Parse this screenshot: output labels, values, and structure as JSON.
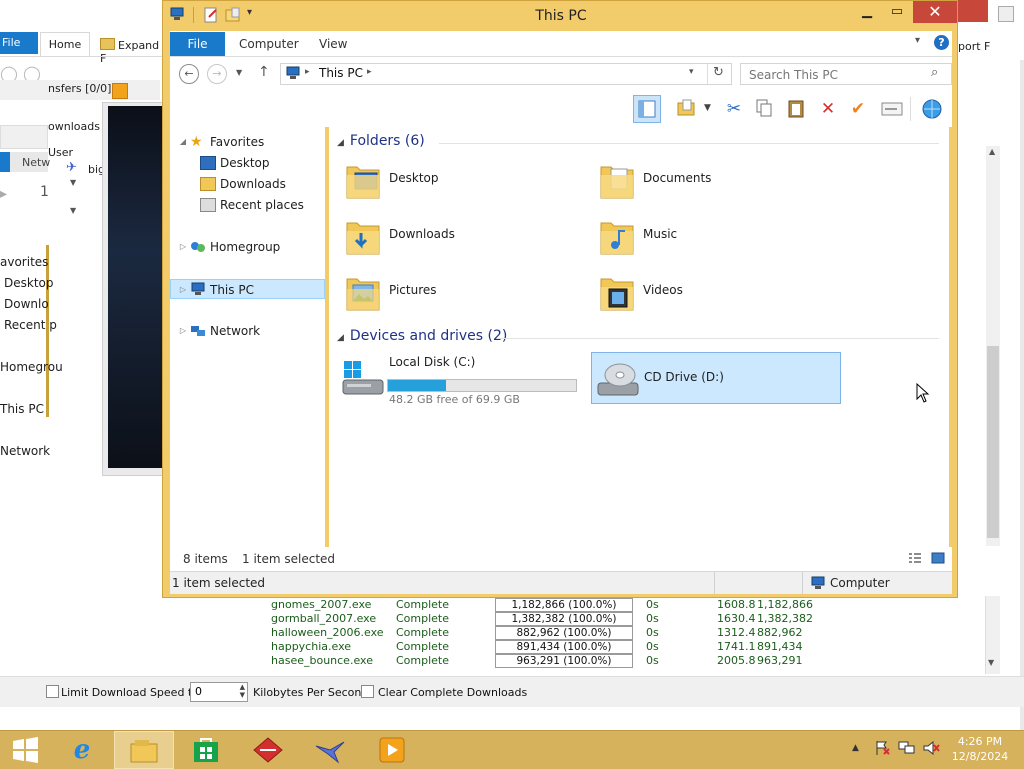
{
  "explorer": {
    "title": "This PC",
    "tabs": {
      "file": "File",
      "computer": "Computer",
      "view": "View"
    },
    "address": {
      "path": "This PC"
    },
    "search": {
      "placeholder": "Search This PC"
    },
    "nav": {
      "favorites": "Favorites",
      "desktop": "Desktop",
      "downloads": "Downloads",
      "recent": "Recent places",
      "homegroup": "Homegroup",
      "this_pc": "This PC",
      "network": "Network"
    },
    "folders": {
      "header": "Folders (6)",
      "items": [
        "Desktop",
        "Documents",
        "Downloads",
        "Music",
        "Pictures",
        "Videos"
      ]
    },
    "devices": {
      "header": "Devices and drives (2)",
      "local_disk": {
        "name": "Local Disk (C:)",
        "free": "48.2 GB free of 69.9 GB",
        "used_fraction": 0.31
      },
      "cd_drive": {
        "name": "CD Drive (D:)"
      }
    },
    "status": {
      "items": "8 items",
      "selected": "1 item selected"
    },
    "statusbar": {
      "selected": "1 item selected",
      "location": "Computer"
    }
  },
  "background": {
    "left_tabs": {
      "file": "File",
      "home": "Home",
      "expand": "Expand F"
    },
    "left_transfers": "nsfers [0/0]",
    "left_downloads": "ownloads",
    "left_user": "User",
    "left_netw": "Netw",
    "left_big": "big",
    "left_nav": [
      "avorites",
      "Desktop",
      "Downlo",
      "Recent p",
      "Homegrou",
      "This PC",
      "Network"
    ],
    "right_export": "port F",
    "downloads": [
      {
        "name": "gnomes_2007.exe",
        "status": "Complete",
        "size": "1,182,866 (100.0%)",
        "time": "0s",
        "rate": "1608.8",
        "bytes": "1,182,866"
      },
      {
        "name": "gormball_2007.exe",
        "status": "Complete",
        "size": "1,382,382 (100.0%)",
        "time": "0s",
        "rate": "1630.4",
        "bytes": "1,382,382"
      },
      {
        "name": "halloween_2006.exe",
        "status": "Complete",
        "size": "882,962 (100.0%)",
        "time": "0s",
        "rate": "1312.4",
        "bytes": "882,962"
      },
      {
        "name": "happychia.exe",
        "status": "Complete",
        "size": "891,434 (100.0%)",
        "time": "0s",
        "rate": "1741.1",
        "bytes": "891,434"
      },
      {
        "name": "hasee_bounce.exe",
        "status": "Complete",
        "size": "963,291 (100.0%)",
        "time": "0s",
        "rate": "2005.8",
        "bytes": "963,291"
      }
    ],
    "bottom": {
      "limit_label": "Limit Download Speed to",
      "limit_value": "0",
      "kbps_label": "Kilobytes Per Second",
      "clear_label": "Clear Complete Downloads"
    }
  },
  "taskbar": {
    "time": "4:26 PM",
    "date": "12/8/2024"
  },
  "colors": {
    "accent": "#1979ca",
    "window_frame": "#f2cc6a",
    "taskbar": "#d7b25c"
  }
}
